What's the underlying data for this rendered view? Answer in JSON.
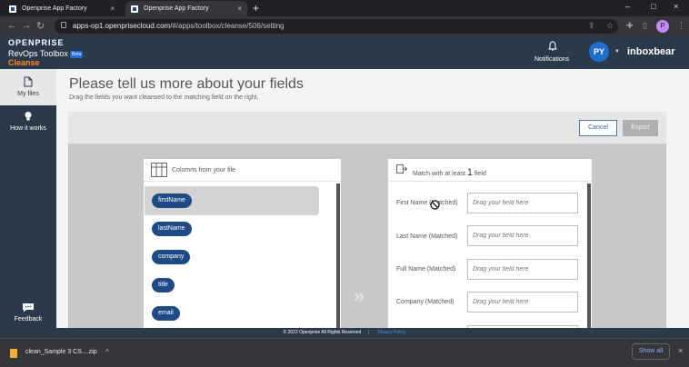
{
  "browser": {
    "tabs": [
      {
        "label": "Openprise App Factory",
        "close": "×"
      },
      {
        "label": "Openprise App Factory",
        "close": "×"
      }
    ],
    "new_tab": "+",
    "window_controls": [
      "–",
      "□",
      "×"
    ],
    "url_host": "apps-op1.openprisecloud.com",
    "url_path": "/#/apps/toolbox/cleanse/506/setting",
    "profile_initial": "P"
  },
  "header": {
    "logo_line1": "OPENPRISE",
    "logo_line2": "RevOps Toolbox",
    "beta": "Beta",
    "product": "Cleanse",
    "notifications_label": "Notifications",
    "user_initials": "PY",
    "username": "inboxbear"
  },
  "sidebar": {
    "items": [
      {
        "label": "My files",
        "icon": "file-icon"
      },
      {
        "label": "How it works",
        "icon": "lightbulb-icon"
      }
    ],
    "feedback": "Feedback"
  },
  "page": {
    "title": "Please tell us more about your fields",
    "subtitle": "Drag the fields you want cleansed to the matching field on the right.",
    "cancel": "Cancel",
    "export": "Export"
  },
  "columns_panel": {
    "header": "Columns from your file",
    "fields": [
      "firstName",
      "lastName",
      "company",
      "title",
      "email"
    ]
  },
  "match_panel": {
    "header_prefix": "Match with at least",
    "header_count": "1",
    "header_suffix": "field",
    "rows": [
      {
        "label": "First Name (Matched)",
        "placeholder": "Drag your field here"
      },
      {
        "label": "Last Name (Matched)",
        "placeholder": "Drag your field here"
      },
      {
        "label": "Full Name (Matched)",
        "placeholder": "Drag your field here"
      },
      {
        "label": "Company (Matched)",
        "placeholder": "Drag your field here"
      }
    ]
  },
  "footer": {
    "copyright": "© 2022 Openprise All Rights Reserved",
    "privacy": "Privacy Policy"
  },
  "downloads": {
    "file": "clean_Sample 3 CS....zip",
    "show_all": "Show all"
  }
}
